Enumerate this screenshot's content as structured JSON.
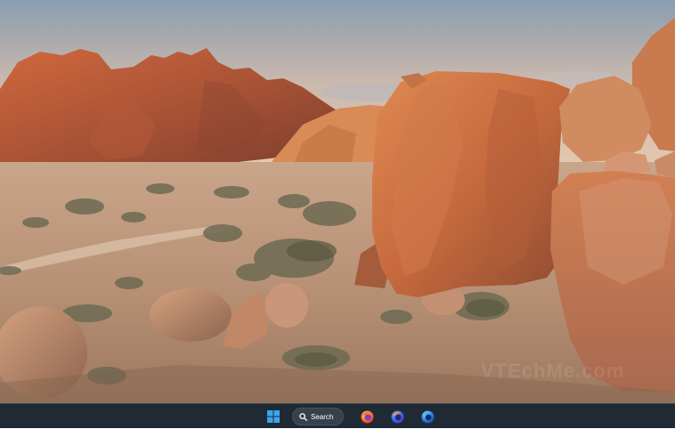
{
  "desktop": {
    "wallpaper": "desert boulders landscape at sunset",
    "watermark": "VTEchMe.com"
  },
  "taskbar": {
    "start_icon": "windows-logo-icon",
    "search": {
      "icon": "search-icon",
      "label": "Search"
    },
    "apps": [
      {
        "name": "Firefox",
        "icon": "firefox-icon"
      },
      {
        "name": "Firefox Developer Edition",
        "icon": "firefox-developer-icon"
      },
      {
        "name": "Firefox Nightly",
        "icon": "firefox-nightly-icon"
      }
    ],
    "colors": {
      "background": "#1f2a34",
      "windows_blue": "#3aa6ee"
    }
  }
}
